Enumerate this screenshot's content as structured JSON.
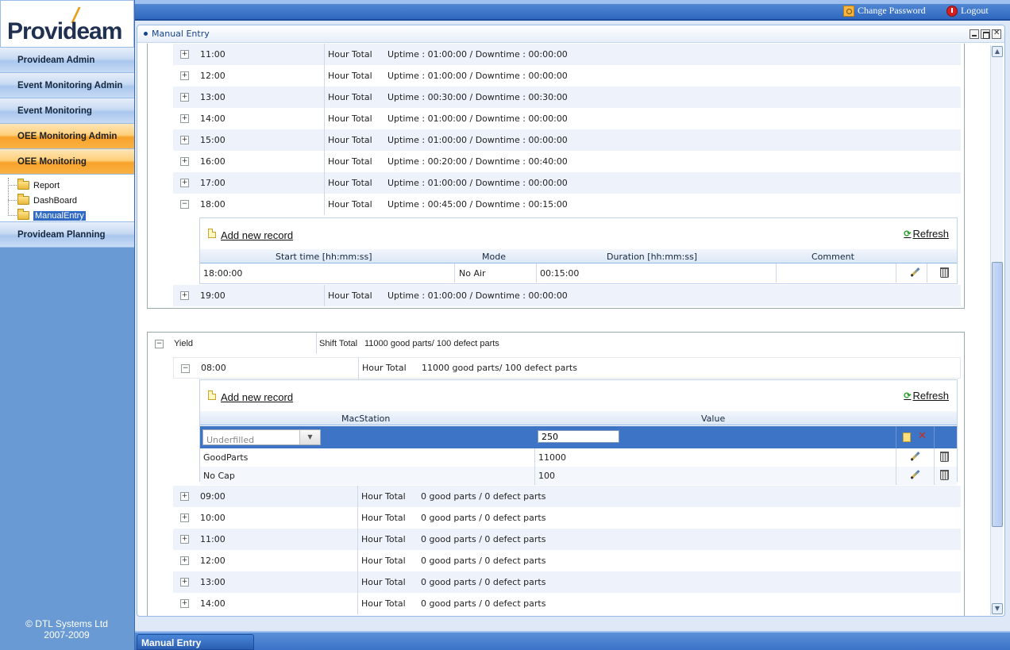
{
  "logo": {
    "text": "Provideam"
  },
  "sidebar": {
    "nav": [
      {
        "label": "Provideam Admin",
        "style": "blue"
      },
      {
        "label": "Event Monitoring Admin",
        "style": "blue"
      },
      {
        "label": "Event Monitoring",
        "style": "blue"
      },
      {
        "label": "OEE Monitoring Admin",
        "style": "orange"
      },
      {
        "label": "OEE Monitoring",
        "style": "orange"
      }
    ],
    "tree": [
      "Report",
      "DashBoard",
      "ManualEntry"
    ],
    "tree_selected": "ManualEntry",
    "nav_after": {
      "label": "Provideam Planning"
    },
    "copyright_line1": "© DTL Systems Ltd",
    "copyright_line2": "2007-2009"
  },
  "topbar": {
    "change_password": "Change Password",
    "logout": "Logout"
  },
  "panel": {
    "title": "Manual Entry"
  },
  "uptime_group": {
    "hour_total_label": "Hour Total",
    "rows": [
      {
        "time": "11:00",
        "summary": "Uptime : 01:00:00 / Downtime : 00:00:00",
        "expanded": false
      },
      {
        "time": "12:00",
        "summary": "Uptime : 01:00:00 / Downtime : 00:00:00",
        "expanded": false
      },
      {
        "time": "13:00",
        "summary": "Uptime : 00:30:00 / Downtime : 00:30:00",
        "expanded": false
      },
      {
        "time": "14:00",
        "summary": "Uptime : 01:00:00 / Downtime : 00:00:00",
        "expanded": false
      },
      {
        "time": "15:00",
        "summary": "Uptime : 01:00:00 / Downtime : 00:00:00",
        "expanded": false
      },
      {
        "time": "16:00",
        "summary": "Uptime : 00:20:00 / Downtime : 00:40:00",
        "expanded": false
      },
      {
        "time": "17:00",
        "summary": "Uptime : 01:00:00 / Downtime : 00:00:00",
        "expanded": false
      },
      {
        "time": "18:00",
        "summary": "Uptime : 00:45:00 / Downtime : 00:15:00",
        "expanded": true
      }
    ],
    "after_row": {
      "time": "19:00",
      "summary": "Uptime : 01:00:00 / Downtime : 00:00:00"
    },
    "detail": {
      "add_label": "Add new record",
      "refresh_label": "Refresh",
      "columns": [
        "Start time [hh:mm:ss]",
        "Mode",
        "Duration [hh:mm:ss]",
        "Comment"
      ],
      "records": [
        {
          "start": "18:00:00",
          "mode": "No Air",
          "duration": "00:15:00",
          "comment": ""
        }
      ]
    }
  },
  "yield_group": {
    "label": "Yield",
    "shift_total_label": "Shift Total",
    "shift_total_value": "11000 good parts/ 100 defect parts",
    "hour_total_label": "Hour Total",
    "expanded_row": {
      "time": "08:00",
      "summary": "11000 good parts/ 100 defect parts"
    },
    "detail": {
      "add_label": "Add new record",
      "refresh_label": "Refresh",
      "columns": [
        "MacStation",
        "Value"
      ],
      "edit_row": {
        "station_placeholder": "Underfilled",
        "value": "250"
      },
      "records": [
        {
          "station": "GoodParts",
          "value": "11000"
        },
        {
          "station": "No Cap",
          "value": "100"
        }
      ]
    },
    "rows": [
      {
        "time": "09:00",
        "summary": "0 good parts / 0 defect parts"
      },
      {
        "time": "10:00",
        "summary": "0 good parts / 0 defect parts"
      },
      {
        "time": "11:00",
        "summary": "0 good parts / 0 defect parts"
      },
      {
        "time": "12:00",
        "summary": "0 good parts / 0 defect parts"
      },
      {
        "time": "13:00",
        "summary": "0 good parts / 0 defect parts"
      },
      {
        "time": "14:00",
        "summary": "0 good parts / 0 defect parts"
      }
    ]
  },
  "taskbar": {
    "tab_label": "Manual Entry"
  },
  "colors": {
    "nav_blue": "#c7daf3",
    "nav_orange": "#f7a22a",
    "header_blue": "#15428b",
    "selected_row": "#3d74c6"
  }
}
